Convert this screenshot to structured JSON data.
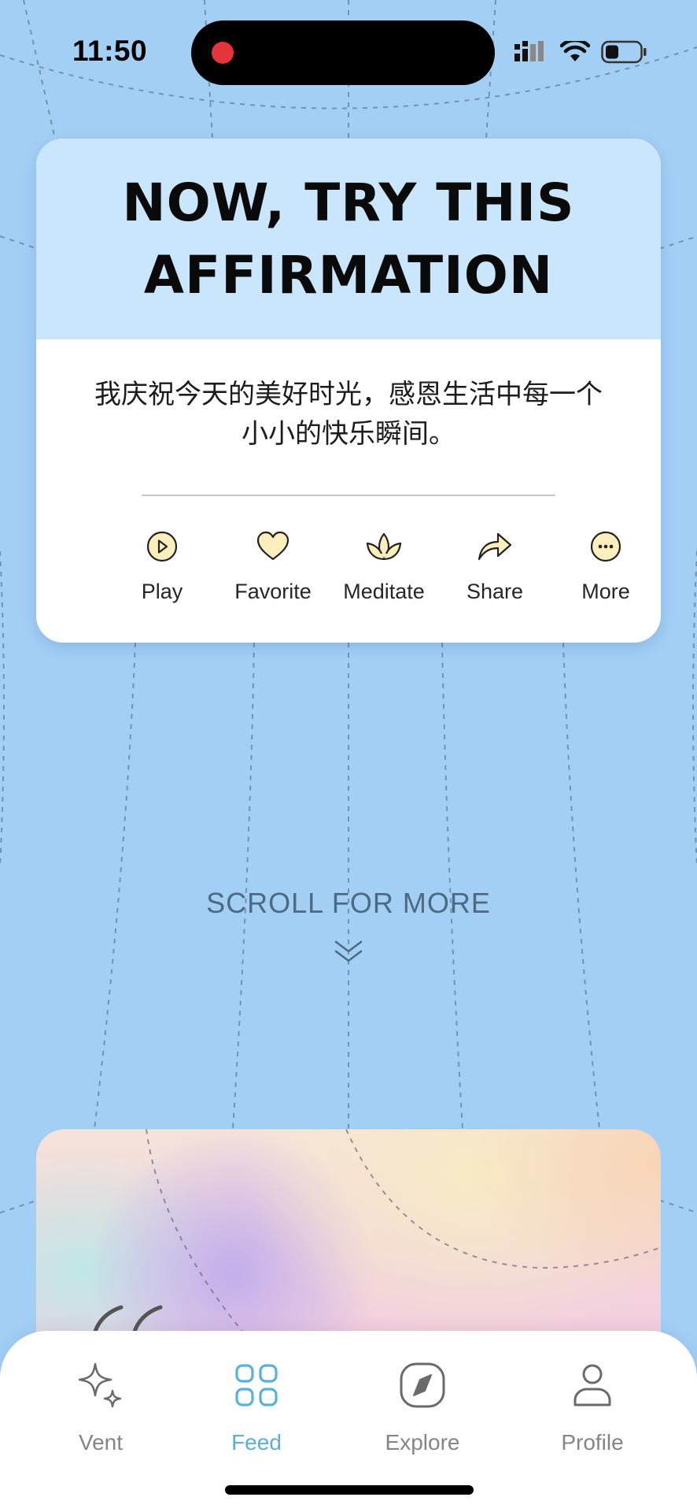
{
  "status_bar": {
    "time": "11:50",
    "recording_color": "#e6353a",
    "icons": [
      "signal-icon",
      "wifi-icon",
      "battery-icon"
    ]
  },
  "affirmation_card": {
    "title_line1": "NOW, TRY THIS",
    "title_line2": "AFFIRMATION",
    "text": "我庆祝今天的美好时光，感恩生活中每一个小小的快乐瞬间。",
    "actions": [
      {
        "label": "Play",
        "icon": "play-icon"
      },
      {
        "label": "Favorite",
        "icon": "heart-icon"
      },
      {
        "label": "Meditate",
        "icon": "lotus-icon"
      },
      {
        "label": "Share",
        "icon": "share-icon"
      },
      {
        "label": "More",
        "icon": "more-icon"
      }
    ],
    "header_color": "#cae6fc",
    "icon_fill": "#fcefbd"
  },
  "scroll_hint": {
    "label": "SCROLL FOR MORE",
    "icon": "double-chevron-down-icon"
  },
  "tab_bar": {
    "tabs": [
      {
        "label": "Vent",
        "icon": "sparkle-icon",
        "active": false
      },
      {
        "label": "Feed",
        "icon": "grid-icon",
        "active": true
      },
      {
        "label": "Explore",
        "icon": "compass-icon",
        "active": false
      },
      {
        "label": "Profile",
        "icon": "person-icon",
        "active": false
      }
    ],
    "active_color": "#5ab0d8"
  },
  "colors": {
    "background": "#a3cff5"
  }
}
